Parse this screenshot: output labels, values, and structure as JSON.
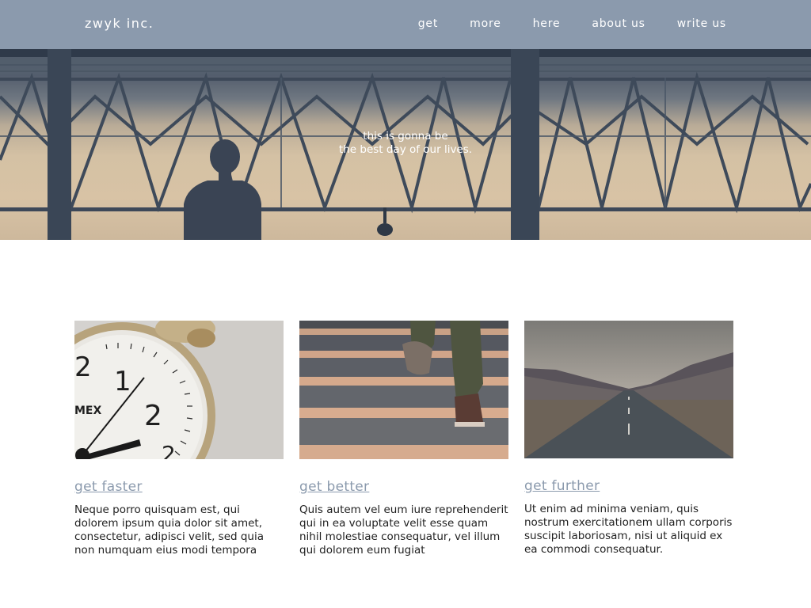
{
  "header": {
    "brand": "zwyk inc.",
    "nav": [
      "get",
      "more",
      "here",
      "about us",
      "write us"
    ]
  },
  "hero": {
    "line1": "this is gonna be",
    "line2": "the best day of our lives."
  },
  "cards": [
    {
      "image": "alarm-clock-photo",
      "title": "get faster",
      "text": "Neque porro quisquam est, qui dolorem ipsum quia dolor sit amet, consectetur, adipisci velit, sed quia non numquam eius modi tempora"
    },
    {
      "image": "stairs-walking-photo",
      "title": "get better",
      "text": "Quis autem vel eum iure reprehenderit qui in ea voluptate velit esse quam nihil molestiae consequatur, vel illum qui dolorem eum fugiat"
    },
    {
      "image": "empty-road-photo",
      "title": "get further",
      "text": "Ut enim ad minima veniam, quis nostrum exercitationem ullam corporis suscipit laboriosam, nisi ut aliquid ex ea commodi consequatur."
    }
  ],
  "clock_numerals": [
    "2",
    "1",
    "2",
    "MEX",
    "2"
  ],
  "colors": {
    "header_bg": "#8b9aad",
    "link": "#8b9aad",
    "text": "#1f1f1f"
  }
}
